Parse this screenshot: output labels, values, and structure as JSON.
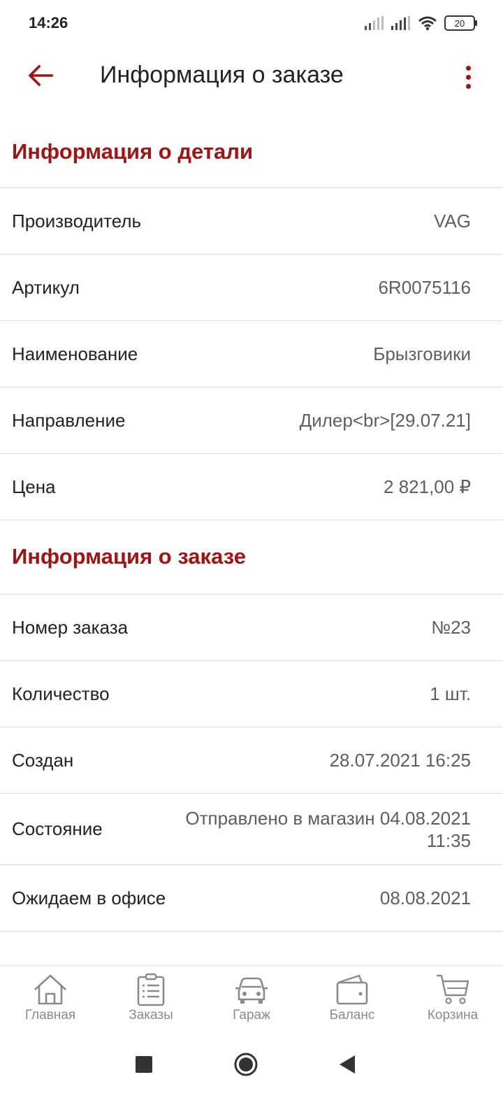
{
  "status_bar": {
    "time": "14:26",
    "battery": "20"
  },
  "app_bar": {
    "title": "Информация о заказе"
  },
  "part_info": {
    "title": "Информация о детали",
    "rows": [
      {
        "label": "Производитель",
        "value": "VAG"
      },
      {
        "label": "Артикул",
        "value": "6R0075116"
      },
      {
        "label": "Наименование",
        "value": "Брызговики"
      },
      {
        "label": "Направление",
        "value": "Дилер<br>[29.07.21]"
      },
      {
        "label": "Цена",
        "value": "2 821,00 ₽"
      }
    ]
  },
  "order_info": {
    "title": "Информация о заказе",
    "rows": [
      {
        "label": "Номер заказа",
        "value": "№23"
      },
      {
        "label": "Количество",
        "value": "1 шт."
      },
      {
        "label": "Создан",
        "value": "28.07.2021 16:25"
      },
      {
        "label": "Состояние",
        "value_line1": "Отправлено в магазин 04.08.2021",
        "value_line2": "11:35"
      },
      {
        "label": "Ожидаем в офисе",
        "value": "08.08.2021"
      }
    ]
  },
  "bottom_nav": {
    "items": [
      {
        "label": "Главная",
        "icon": "home-icon"
      },
      {
        "label": "Заказы",
        "icon": "orders-icon"
      },
      {
        "label": "Гараж",
        "icon": "car-icon"
      },
      {
        "label": "Баланс",
        "icon": "wallet-icon"
      },
      {
        "label": "Корзина",
        "icon": "cart-icon"
      }
    ]
  },
  "colors": {
    "accent": "#a01414",
    "text": "#222222",
    "secondary_text": "#5e5e5e",
    "nav_inactive": "#8a8a8a",
    "divider": "#dcdcdc"
  }
}
